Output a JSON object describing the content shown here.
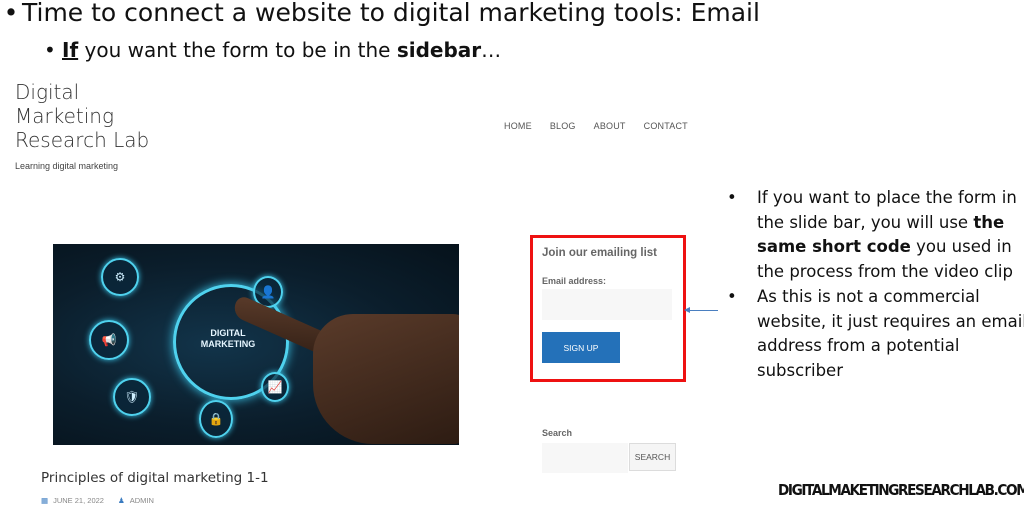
{
  "slide": {
    "title": "Time to connect a website to digital marketing tools: Email",
    "subtitle_parts": {
      "underlined_bold": "If",
      "text_before_bold": " you want the form to be in the ",
      "bold": "sidebar",
      "text_after": "…"
    },
    "bullet_glyph": "•",
    "footer_url": "DIGITALMAKETINGRESEARCHLAB.COM"
  },
  "site": {
    "title_lines": [
      "Digital",
      "Marketing",
      "Research Lab"
    ],
    "tagline": "Learning digital marketing",
    "nav": [
      "HOME",
      "BLOG",
      "ABOUT",
      "CONTACT"
    ]
  },
  "post": {
    "image_text_lines": [
      "DIGITAL",
      "MARKETING"
    ],
    "title": "Principles of digital marketing 1-1",
    "date_icon": "calendar-icon",
    "date": "JUNE 21, 2022",
    "author_icon": "user-icon",
    "author": "ADMIN"
  },
  "signup_form": {
    "heading": "Join our emailing list",
    "email_label": "Email address:",
    "email_value": "",
    "button_label": "SIGN UP",
    "highlight_color": "#ee1111",
    "button_color": "#2471b9"
  },
  "search_widget": {
    "label": "Search",
    "value": "",
    "button_label": "SEARCH"
  },
  "notes": {
    "item1": {
      "pre": "If you want to place the form in the slide bar, you will use ",
      "bold": "the same short code",
      "post": " you used in the process from the video clip"
    },
    "item2": "As this is not a commercial website, it just requires an email address from a potential subscriber"
  }
}
